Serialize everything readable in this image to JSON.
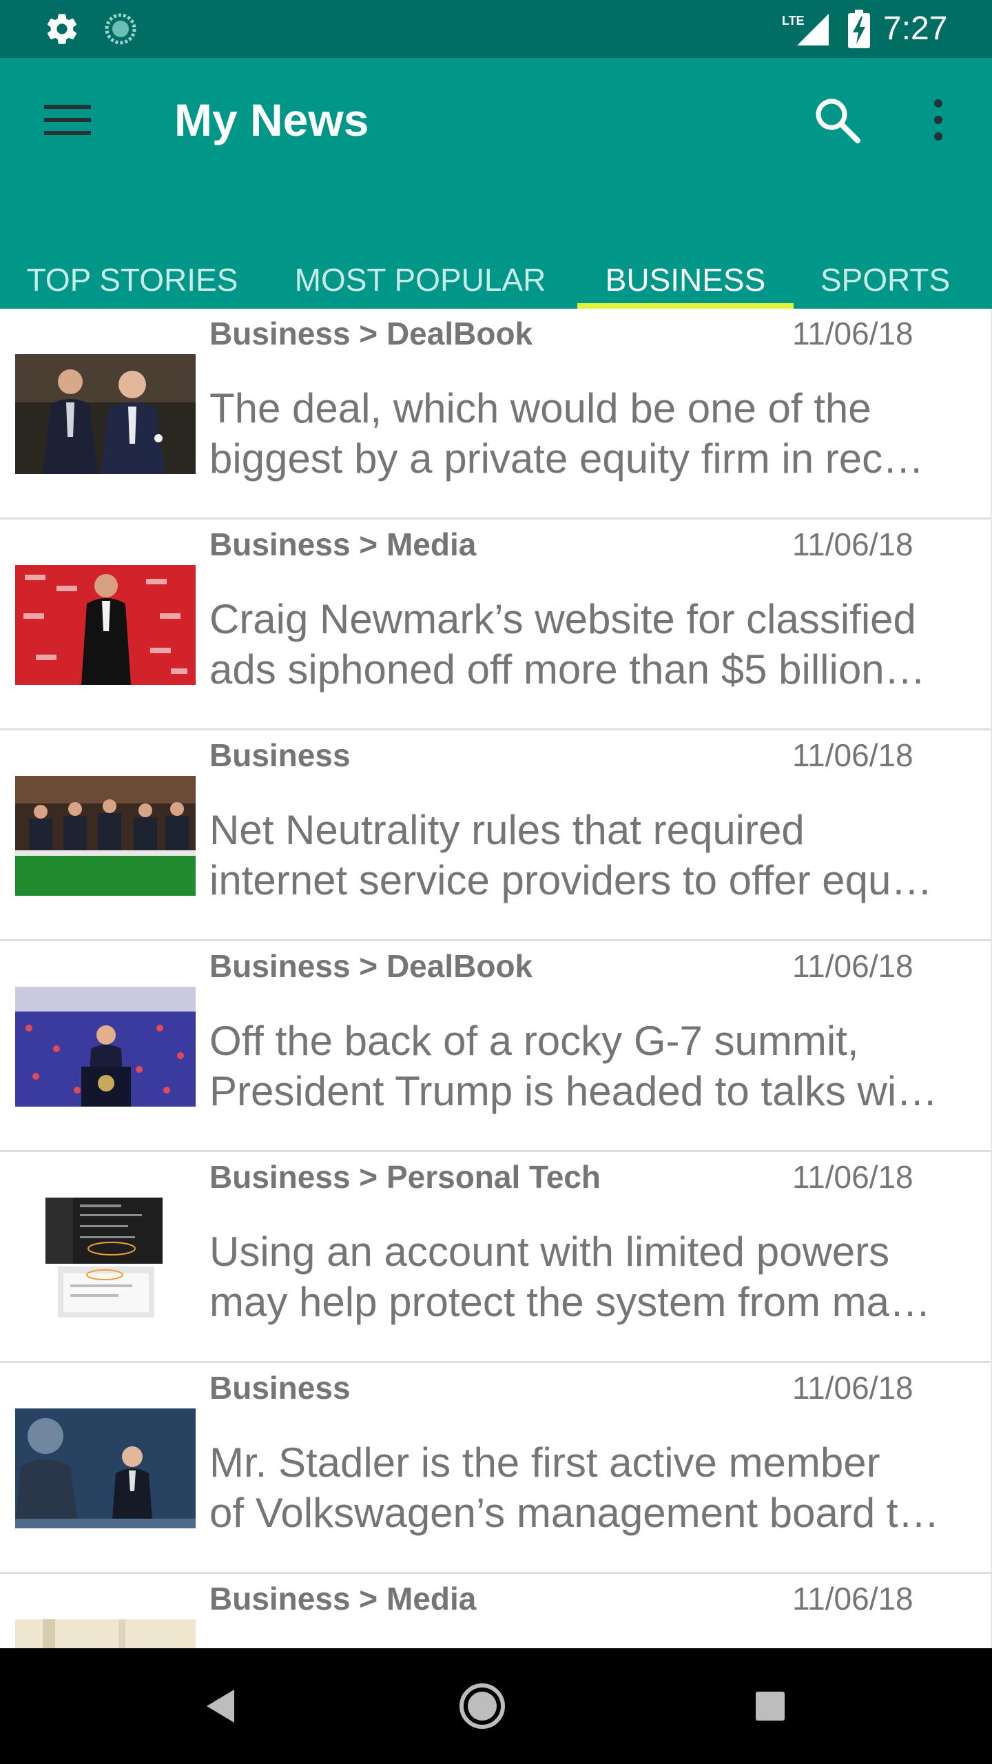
{
  "status_bar": {
    "time": "7:27",
    "network": "LTE",
    "icons": [
      "gear-icon",
      "sync-ring-icon",
      "lte-signal-icon",
      "battery-charging-icon"
    ]
  },
  "app_bar": {
    "title": "My News",
    "menu_icon": "hamburger-menu-icon",
    "search_icon": "search-icon",
    "overflow_icon": "more-vert-icon",
    "background": "#009688",
    "status_background": "#006e63"
  },
  "tabs": {
    "items": [
      {
        "label": "TOP STORIES"
      },
      {
        "label": "MOST POPULAR"
      },
      {
        "label": "BUSINESS"
      },
      {
        "label": "SPORTS"
      }
    ],
    "active": "BUSINESS",
    "indicator_color": "#e3f23a"
  },
  "articles": [
    {
      "section": "Business > DealBook",
      "date": "11/06/18",
      "abstract_line1": "The deal, which would be one of the",
      "abstract_line2": "biggest by a private equity firm in rec…",
      "thumb": "two-men-in-suits-photo"
    },
    {
      "section": "Business > Media",
      "date": "11/06/18",
      "abstract_line1": "Craig Newmark’s website for classified",
      "abstract_line2": "ads siphoned off more than $5 billion…",
      "thumb": "man-at-red-carpet-photo"
    },
    {
      "section": "Business",
      "date": "11/06/18",
      "abstract_line1": "Net Neutrality rules that required",
      "abstract_line2": "internet service providers to offer equ…",
      "thumb": "hearing-panel-photo"
    },
    {
      "section": "Business > DealBook",
      "date": "11/06/18",
      "abstract_line1": "Off the back of a rocky G-7 summit,",
      "abstract_line2": "President Trump is headed to talks wi…",
      "thumb": "summit-podium-photo"
    },
    {
      "section": "Business > Personal Tech",
      "date": "11/06/18",
      "abstract_line1": "Using an account with limited powers",
      "abstract_line2": "may help protect the system from ma…",
      "thumb": "settings-screenshots-photo"
    },
    {
      "section": "Business",
      "date": "11/06/18",
      "abstract_line1": "Mr. Stadler is the first active member",
      "abstract_line2": "of Volkswagen’s management board t…",
      "thumb": "speaker-on-stage-photo"
    },
    {
      "section": "Business > Media",
      "date": "11/06/18",
      "abstract_line1": "",
      "abstract_line2": "",
      "thumb": "partial-photo"
    }
  ],
  "nav_bar": {
    "icons": [
      "back-icon",
      "home-icon",
      "recent-apps-icon"
    ]
  }
}
